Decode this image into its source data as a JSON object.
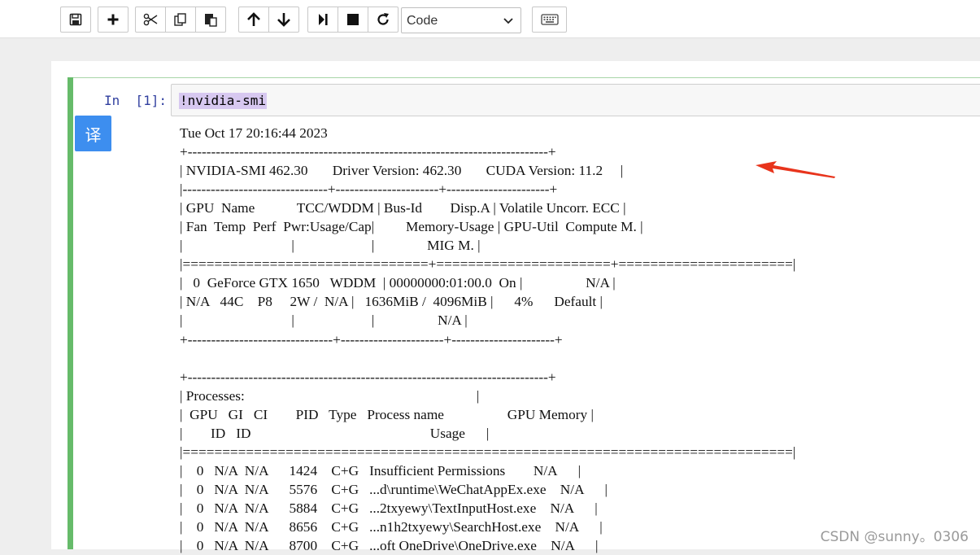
{
  "toolbar": {
    "buttons": [
      {
        "name": "save-icon"
      },
      {
        "name": "add-cell-icon"
      },
      {
        "name": "cut-icon"
      },
      {
        "name": "copy-icon"
      },
      {
        "name": "paste-icon"
      },
      {
        "name": "move-up-icon"
      },
      {
        "name": "move-down-icon"
      },
      {
        "name": "run-icon"
      },
      {
        "name": "stop-icon"
      },
      {
        "name": "restart-icon"
      },
      {
        "name": "keyboard-icon"
      }
    ],
    "cell_type_selected": "Code"
  },
  "cell": {
    "prompt": "In  [1]:",
    "code": "!nvidia-smi",
    "translate_label": "译",
    "output_lines": [
      "Tue Oct 17 20:16:44 2023",
      "+-----------------------------------------------------------------------------+",
      "| NVIDIA-SMI 462.30       Driver Version: 462.30       CUDA Version: 11.2     |",
      "|-------------------------------+----------------------+----------------------+",
      "| GPU  Name            TCC/WDDM | Bus-Id        Disp.A | Volatile Uncorr. ECC |",
      "| Fan  Temp  Perf  Pwr:Usage/Cap|         Memory-Usage | GPU-Util  Compute M. |",
      "|                               |                      |               MIG M. |",
      "|===============================+======================+======================|",
      "|   0  GeForce GTX 1650   WDDM  | 00000000:01:00.0  On |                  N/A |",
      "| N/A   44C    P8     2W /  N/A |   1636MiB /  4096MiB |      4%      Default |",
      "|                               |                      |                  N/A |",
      "+-------------------------------+----------------------+----------------------+",
      "",
      "+-----------------------------------------------------------------------------+",
      "| Processes:                                                                  |",
      "|  GPU   GI   CI        PID   Type   Process name                  GPU Memory |",
      "|        ID   ID                                                   Usage      |",
      "|=============================================================================|",
      "|    0   N/A  N/A      1424    C+G   Insufficient Permissions        N/A      |",
      "|    0   N/A  N/A      5576    C+G   ...d\\runtime\\WeChatAppEx.exe    N/A      |",
      "|    0   N/A  N/A      5884    C+G   ...2txyewy\\TextInputHost.exe    N/A      |",
      "|    0   N/A  N/A      8656    C+G   ...n1h2txyewy\\SearchHost.exe    N/A      |",
      "|    0   N/A  N/A      8700    C+G   ...oft OneDrive\\OneDrive.exe    N/A      |"
    ]
  },
  "colors": {
    "cell_bar": "#66bb6a",
    "prompt": "#303f9f",
    "selection": "#d7c8f0",
    "translate_button": "#3d8eef",
    "annotation_arrow": "#e8341c"
  },
  "watermark": "CSDN @sunny。0306"
}
